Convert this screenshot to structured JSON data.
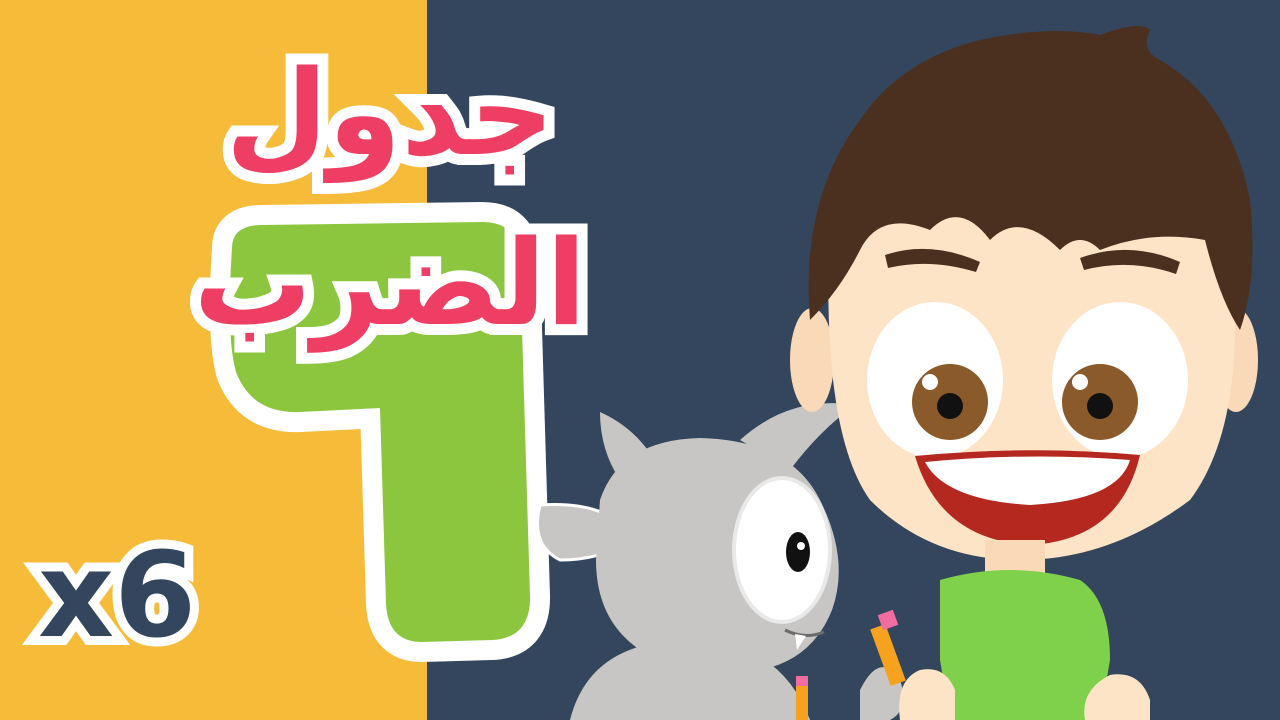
{
  "title": "جدول الضرب",
  "numeral": "٦",
  "multiplier": "x6",
  "colors": {
    "left_panel": "#f7bb3a",
    "right_panel": "#34465d",
    "title_text": "#ef3e63",
    "numeral_fill": "#8cc63f",
    "multiplier_text": "#34465d",
    "outline": "#ffffff"
  }
}
